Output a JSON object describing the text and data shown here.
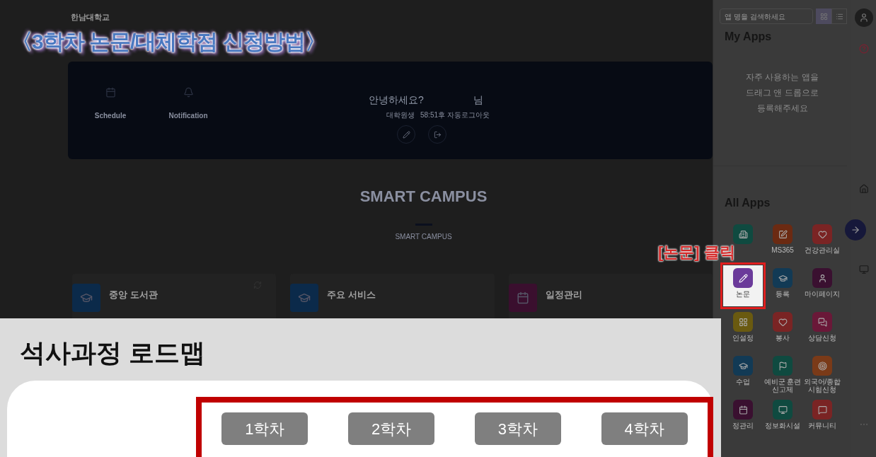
{
  "annotation": {
    "title": "〈3학차 논문/대체학점 신청방법〉",
    "callout": "[논문] 클릭"
  },
  "header": {
    "logo": "한남대학교"
  },
  "profile": {
    "widgets": [
      {
        "label": "Schedule",
        "kind": "calendar"
      },
      {
        "label": "Notification",
        "kind": "bell"
      }
    ],
    "greeting": "안녕하세요?",
    "suffix": "님",
    "role": "대학원생",
    "timer": "58:51후 자동로그아웃"
  },
  "section": {
    "title": "SMART CAMPUS",
    "subtitle": "SMART CAMPUS"
  },
  "cards": [
    {
      "title": "중앙 도서관",
      "color": "#0b2a4a",
      "kind": "cap",
      "refresh": true
    },
    {
      "title": "주요 서비스",
      "color": "#0b2a4a",
      "kind": "cap",
      "refresh": false
    },
    {
      "title": "일정관리",
      "color": "#3a0f2e",
      "kind": "calendar",
      "refresh": false
    }
  ],
  "apps_panel": {
    "search": {
      "placeholder": "앱 명을 검색하세요"
    },
    "view_toggle": [
      {
        "kind": "grid",
        "selected": true
      },
      {
        "kind": "list",
        "selected": false
      }
    ],
    "my_apps": {
      "title": "My Apps",
      "empty": "자주 사용하는 앱을 드래그 앤 드롭으로 등록해주세요"
    },
    "all_apps": {
      "title": "All Apps",
      "apps": [
        {
          "kind": "building",
          "color": "#0f4a40",
          "highlighted": false
        },
        {
          "label": "MS365",
          "kind": "edit",
          "color": "#6b2a12",
          "highlighted": false
        },
        {
          "label": "건강관리실",
          "kind": "heart",
          "color": "#7a2424",
          "highlighted": false
        },
        {
          "label": "논문",
          "kind": "pencil",
          "color": "#6b3a9a",
          "highlighted": true
        },
        {
          "label": "등록",
          "kind": "cap",
          "color": "#123a55",
          "highlighted": false
        },
        {
          "label": "마이페이지",
          "kind": "user",
          "color": "#3a1030",
          "highlighted": false
        },
        {
          "label": "인설정",
          "kind": "grid",
          "color": "#6a5a10",
          "highlighted": false
        },
        {
          "label": "봉사",
          "kind": "heart",
          "color": "#7a2424",
          "highlighted": false
        },
        {
          "label": "상담신청",
          "kind": "chat",
          "color": "#6a1838",
          "highlighted": false
        },
        {
          "label": "수업",
          "kind": "cap",
          "color": "#123a55",
          "highlighted": false
        },
        {
          "label": "예비군 훈련 신고제",
          "kind": "flag",
          "color": "#0f4a40",
          "highlighted": false
        },
        {
          "label": "외국어/종합시험신청",
          "kind": "target",
          "color": "#7a3a18",
          "highlighted": false
        },
        {
          "label": "정관리",
          "kind": "calendar",
          "color": "#3a1030",
          "highlighted": false
        },
        {
          "label": "정보화시설",
          "kind": "monitor",
          "color": "#0f4a40",
          "highlighted": false
        },
        {
          "label": "커뮤니티",
          "kind": "message",
          "color": "#7a2424",
          "highlighted": false
        }
      ]
    }
  },
  "roadmap": {
    "title": "석사과정 로드맵",
    "terms": [
      "1학차",
      "2학차",
      "3학차",
      "4학차"
    ]
  }
}
